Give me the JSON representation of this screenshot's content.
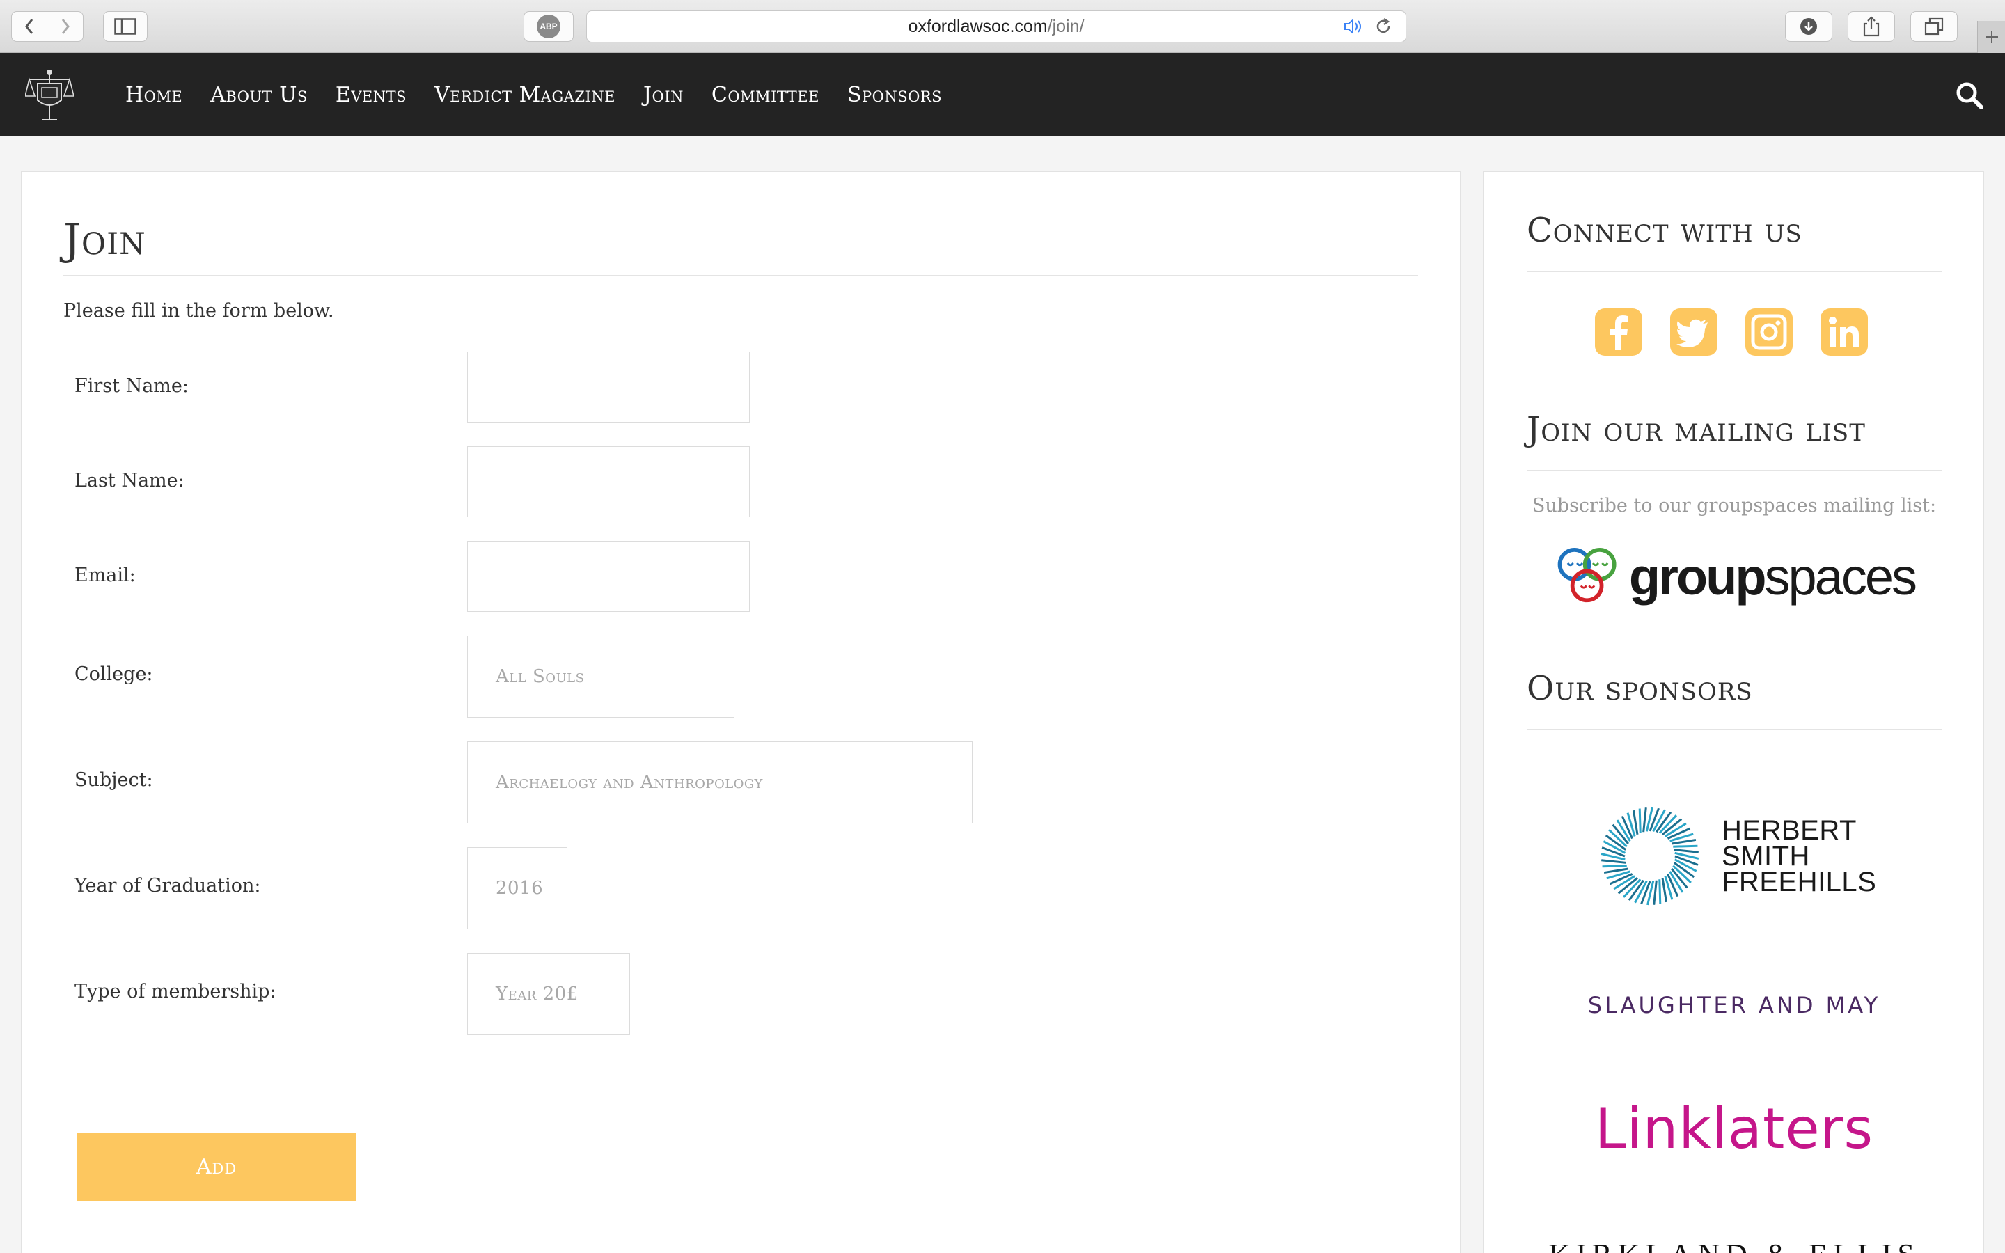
{
  "browser": {
    "url_domain": "oxfordlawsoc.com",
    "url_path": "/join/",
    "adblock_label": "ABP"
  },
  "nav": {
    "items": [
      "Home",
      "About Us",
      "Events",
      "Verdict Magazine",
      "Join",
      "Committee",
      "Sponsors"
    ]
  },
  "main": {
    "title": "Join",
    "intro": "Please fill in the form below.",
    "fields": {
      "first_name": {
        "label": "First Name:",
        "value": ""
      },
      "last_name": {
        "label": "Last Name:",
        "value": ""
      },
      "email": {
        "label": "Email:",
        "value": ""
      },
      "college": {
        "label": "College:",
        "selected": "All Souls"
      },
      "subject": {
        "label": "Subject:",
        "selected": "Archaelogy and Anthropology"
      },
      "year": {
        "label": "Year of Graduation:",
        "selected": "2016"
      },
      "membership": {
        "label": "Type of membership:",
        "selected": "Year 20£"
      }
    },
    "add_label": "Add"
  },
  "sidebar": {
    "connect_title": "Connect with us",
    "social_icons": [
      "facebook-icon",
      "twitter-icon",
      "instagram-icon",
      "linkedin-icon"
    ],
    "mailing_title": "Join our mailing list",
    "mailing_text": "Subscribe to our groupspaces mailing list:",
    "groupspaces": {
      "bold": "group",
      "light": "spaces"
    },
    "sponsors_title": "Our sponsors",
    "sponsors": {
      "hsf_line1": "HERBERT",
      "hsf_line2": "SMITH",
      "hsf_line3": "FREEHILLS",
      "slaughter": "SLAUGHTER AND MAY",
      "linklaters": "Linklaters",
      "kirkland": "KIRKLAND & ELLIS"
    }
  },
  "colors": {
    "accent": "#fdc75f",
    "nav_bg": "#232323",
    "linklaters": "#c5168a",
    "slaughter": "#4b2a63",
    "hsf_blue": "#1f8fb0"
  }
}
